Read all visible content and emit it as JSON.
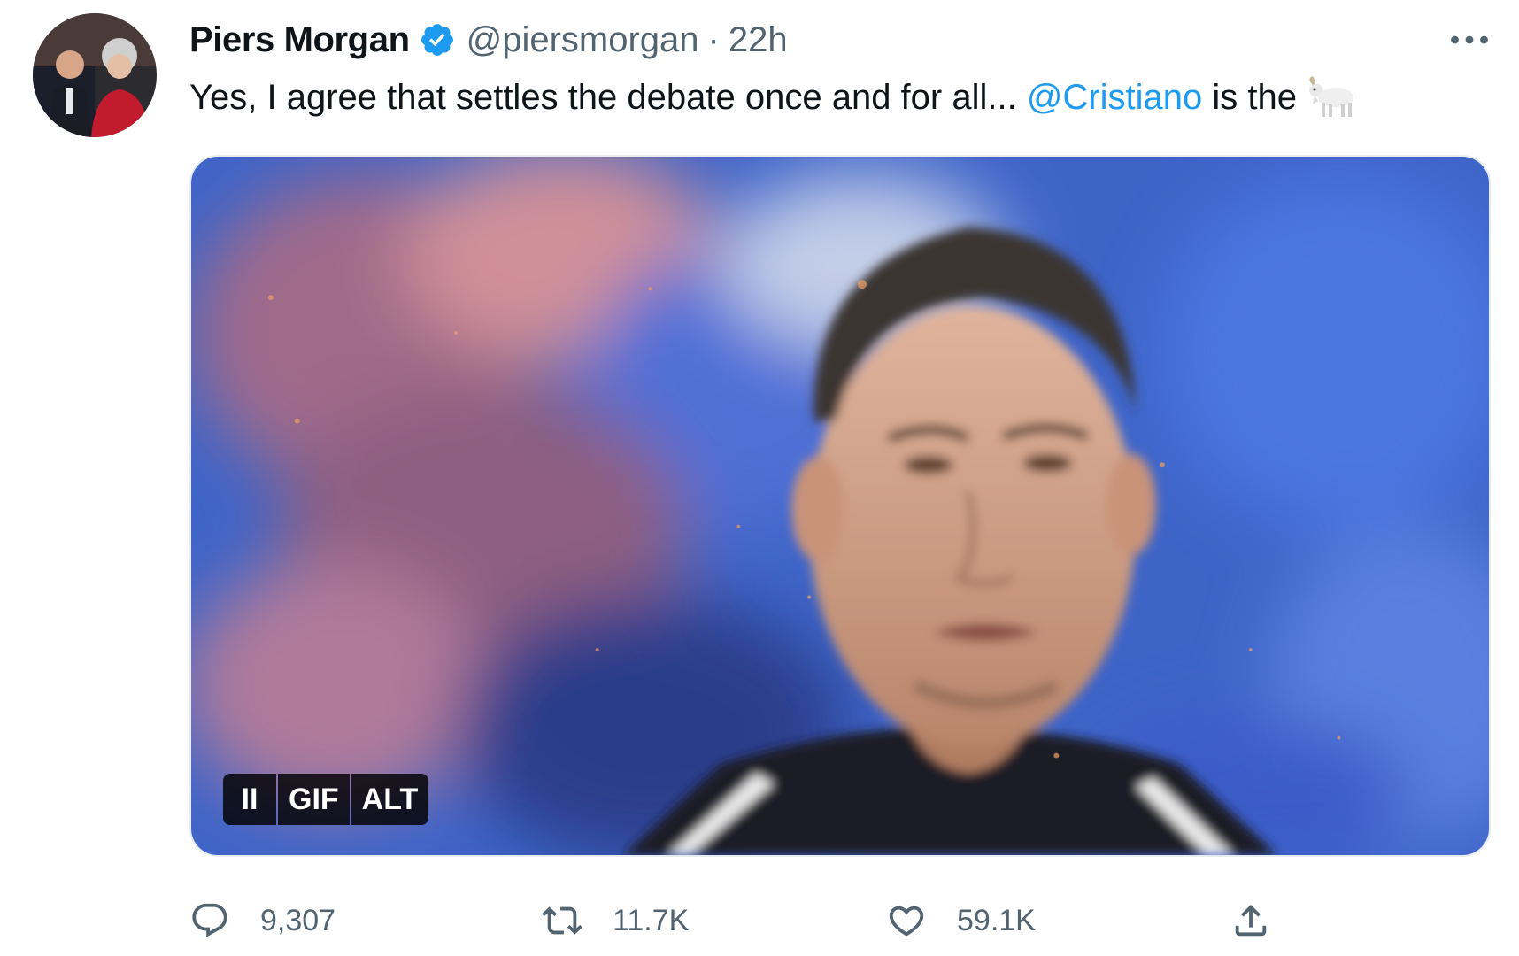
{
  "tweet": {
    "author": {
      "display_name": "Piers Morgan",
      "verified": true,
      "handle": "@piersmorgan",
      "separator": "·",
      "timestamp": "22h"
    },
    "text": {
      "before_mention": "Yes, I agree that settles the debate once and for all...",
      "mention": "@Cristiano",
      "after_mention": "is the",
      "emoji_icon": "goat-emoji-icon"
    },
    "media": {
      "type": "GIF",
      "badges": {
        "pause_label": "II",
        "gif_label": "GIF",
        "alt_label": "ALT"
      }
    },
    "stats": {
      "replies": "9,307",
      "retweets": "11.7K",
      "likes": "59.1K"
    }
  },
  "colors": {
    "accent": "#1d9bf0",
    "text_primary": "#0f1419",
    "text_secondary": "#536471"
  }
}
